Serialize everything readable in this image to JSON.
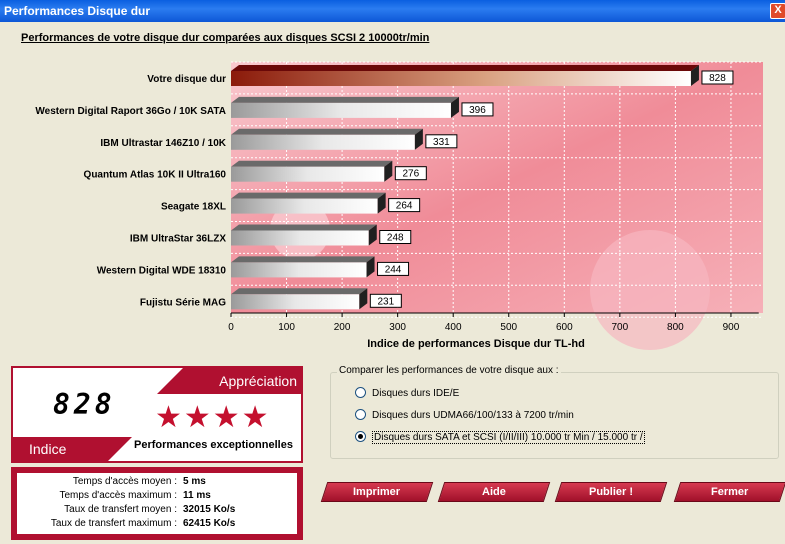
{
  "window": {
    "title": "Performances Disque dur",
    "close_label": "X"
  },
  "chart_heading": "Performances de votre disque dur comparées aux disques SCSI 2 10000tr/min",
  "chart_data": {
    "type": "bar",
    "orientation": "horizontal",
    "categories": [
      "Votre disque dur",
      "Western Digital Raport 36Go / 10K SATA",
      "IBM Ultrastar 146Z10 / 10K",
      "Quantum Atlas 10K II Ultra160",
      "Seagate 18XL",
      "IBM UltraStar 36LZX",
      "Western Digital WDE 18310",
      "Fujistu Série MAG"
    ],
    "values": [
      828,
      396,
      331,
      276,
      264,
      248,
      244,
      231
    ],
    "xlabel": "Indice de performances Disque dur TL-hd",
    "xlim": [
      0,
      950
    ],
    "xticks": [
      0,
      100,
      200,
      300,
      400,
      500,
      600,
      700,
      800,
      900
    ],
    "grid": true
  },
  "indice": {
    "appreciation_label": "Appréciation",
    "indice_label": "Indice",
    "score": "828",
    "stars": "★★★★",
    "rating_text": "Performances exceptionnelles"
  },
  "stats": [
    {
      "label": "Temps d'accès moyen :",
      "value": "5 ms"
    },
    {
      "label": "Temps d'accès maximum :",
      "value": "11 ms"
    },
    {
      "label": "Taux de transfert moyen :",
      "value": "32015 Ko/s"
    },
    {
      "label": "Taux de transfert maximum :",
      "value": "62415 Ko/s"
    }
  ],
  "compare": {
    "legend": "Comparer les performances de votre disque aux :",
    "options": [
      {
        "label": "Disques durs IDE/E",
        "selected": false
      },
      {
        "label": "Disques durs UDMA66/100/133 à 7200 tr/min",
        "selected": false
      },
      {
        "label": "Disques durs SATA et SCSI (I/II/III) 10.000 tr Min / 15.000 tr /",
        "selected": true
      }
    ]
  },
  "buttons": {
    "print": "Imprimer",
    "help": "Aide",
    "publish": "Publier !",
    "close": "Fermer"
  },
  "colors": {
    "accent": "#b01030",
    "plot_bg": "#f3a8b0",
    "your_bar": "#8b1a1a"
  }
}
